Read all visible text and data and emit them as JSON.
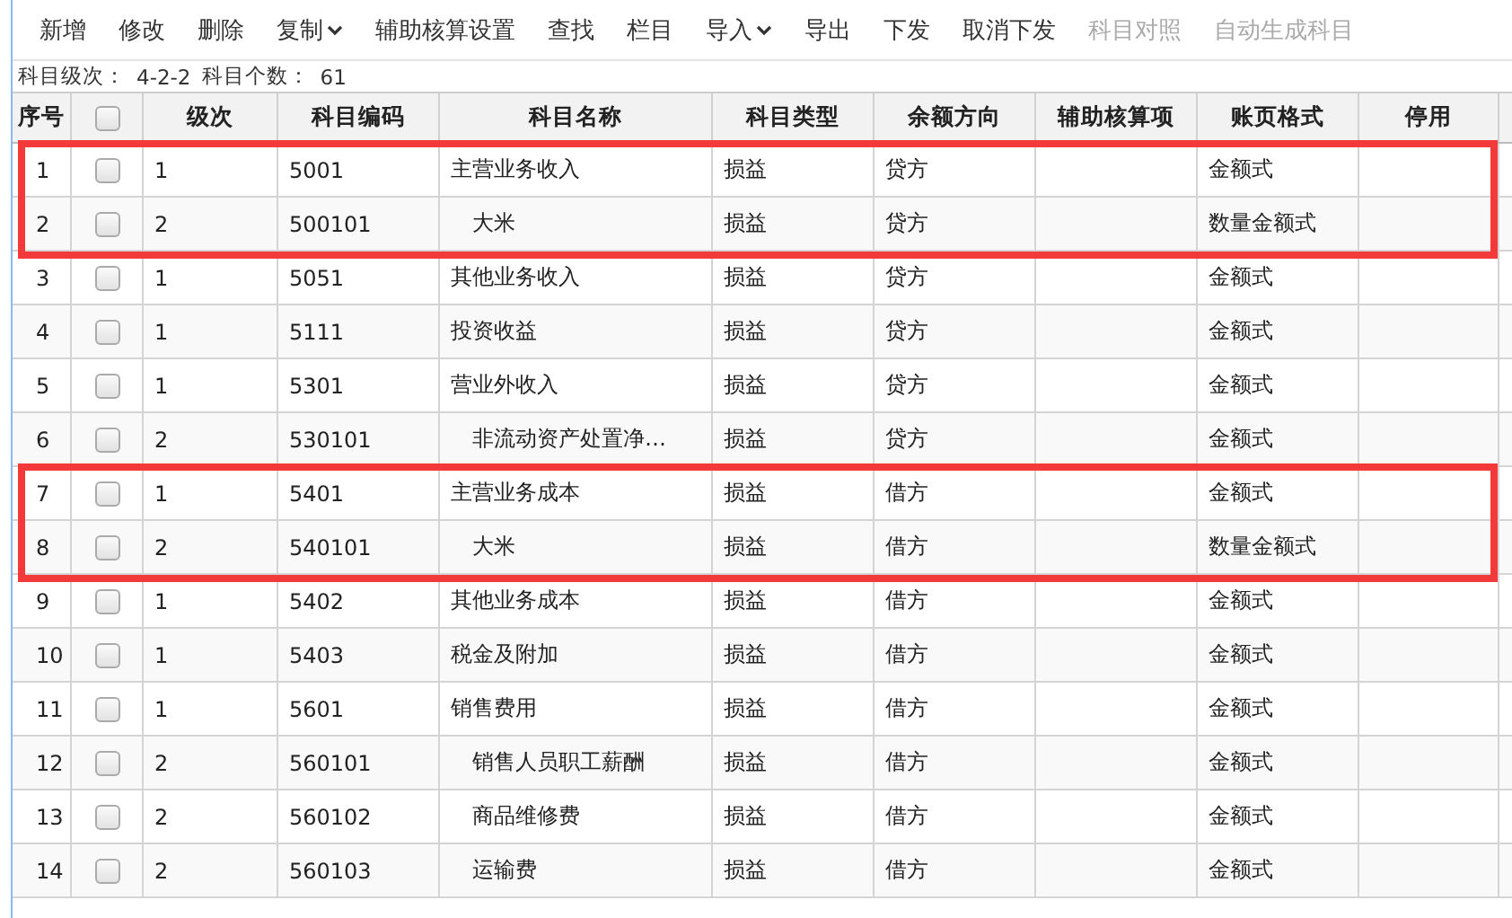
{
  "toolbar": [
    {
      "label": "新增",
      "disabled": false,
      "dropdown": false
    },
    {
      "label": "修改",
      "disabled": false,
      "dropdown": false
    },
    {
      "label": "删除",
      "disabled": false,
      "dropdown": false
    },
    {
      "label": "复制",
      "disabled": false,
      "dropdown": true
    },
    {
      "label": "辅助核算设置",
      "disabled": false,
      "dropdown": false
    },
    {
      "label": "查找",
      "disabled": false,
      "dropdown": false
    },
    {
      "label": "栏目",
      "disabled": false,
      "dropdown": false
    },
    {
      "label": "导入",
      "disabled": false,
      "dropdown": true
    },
    {
      "label": "导出",
      "disabled": false,
      "dropdown": false
    },
    {
      "label": "下发",
      "disabled": false,
      "dropdown": false
    },
    {
      "label": "取消下发",
      "disabled": false,
      "dropdown": false
    },
    {
      "label": "科目对照",
      "disabled": true,
      "dropdown": false
    },
    {
      "label": "自动生成科目",
      "disabled": true,
      "dropdown": false
    }
  ],
  "summary": {
    "levels_label": "科目级次：",
    "levels": "4-2-2",
    "count_label": "科目个数：",
    "count": "61"
  },
  "table": {
    "columns": [
      "序号",
      "",
      "级次",
      "科目编码",
      "科目名称",
      "科目类型",
      "余额方向",
      "辅助核算项",
      "账页格式",
      "停用"
    ],
    "header_checkbox": {
      "checked": false
    },
    "rows": [
      {
        "no": "1",
        "checked": false,
        "level": "1",
        "code": "5001",
        "name": "主营业务收入",
        "type": "损益",
        "direction": "贷方",
        "format": "金额式",
        "boxed": true,
        "children": [
          {
            "no": "2",
            "checked": false,
            "level": "2",
            "code": "500101",
            "name": "大米",
            "type": "损益",
            "direction": "贷方",
            "format": "数量金额式",
            "boxed": true
          }
        ]
      },
      {
        "no": "3",
        "checked": false,
        "level": "1",
        "code": "5051",
        "name": "其他业务收入",
        "type": "损益",
        "direction": "贷方",
        "format": "金额式",
        "boxed": false
      },
      {
        "no": "4",
        "checked": false,
        "level": "1",
        "code": "5111",
        "name": "投资收益",
        "type": "损益",
        "direction": "贷方",
        "format": "金额式",
        "boxed": false
      },
      {
        "no": "5",
        "checked": false,
        "level": "1",
        "code": "5301",
        "name": "营业外收入",
        "type": "损益",
        "direction": "贷方",
        "format": "金额式",
        "boxed": false,
        "children": [
          {
            "no": "6",
            "checked": false,
            "level": "2",
            "code": "530101",
            "name": "非流动资产处置净…",
            "type": "损益",
            "direction": "贷方",
            "format": "金额式",
            "boxed": false
          }
        ]
      },
      {
        "no": "7",
        "checked": false,
        "level": "1",
        "code": "5401",
        "name": "主营业务成本",
        "type": "损益",
        "direction": "借方",
        "format": "金额式",
        "boxed": true,
        "children": [
          {
            "no": "8",
            "checked": false,
            "level": "2",
            "code": "540101",
            "name": "大米",
            "type": "损益",
            "direction": "借方",
            "format": "数量金额式",
            "boxed": true
          }
        ]
      },
      {
        "no": "9",
        "checked": false,
        "level": "1",
        "code": "5402",
        "name": "其他业务成本",
        "type": "损益",
        "direction": "借方",
        "format": "金额式",
        "boxed": false
      },
      {
        "no": "10",
        "checked": false,
        "level": "1",
        "code": "5403",
        "name": "税金及附加",
        "type": "损益",
        "direction": "借方",
        "format": "金额式",
        "boxed": false
      },
      {
        "no": "11",
        "checked": false,
        "level": "1",
        "code": "5601",
        "name": "销售费用",
        "type": "损益",
        "direction": "借方",
        "format": "金额式",
        "boxed": false,
        "children": [
          {
            "no": "12",
            "checked": false,
            "level": "2",
            "code": "560101",
            "name": "销售人员职工薪酬",
            "type": "损益",
            "direction": "借方",
            "format": "金额式",
            "boxed": false
          },
          {
            "no": "13",
            "checked": false,
            "level": "2",
            "code": "560102",
            "name": "商品维修费",
            "type": "损益",
            "direction": "借方",
            "format": "金额式",
            "boxed": false
          },
          {
            "no": "14",
            "checked": false,
            "level": "2",
            "code": "560103",
            "name": "运输费",
            "type": "损益",
            "direction": "借方",
            "format": "金额式",
            "boxed": false
          }
        ]
      }
    ]
  }
}
